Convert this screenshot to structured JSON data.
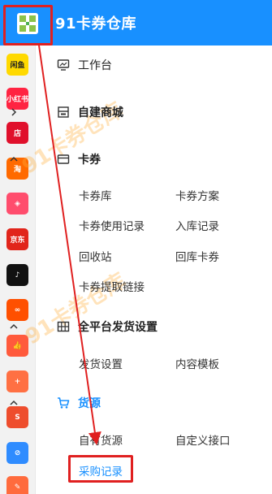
{
  "brand": {
    "title": "91卡券仓库"
  },
  "rail_icons": [
    {
      "name": "xianyu-app-icon",
      "label": "闲鱼",
      "bg": "#ffd900",
      "fg": "#222"
    },
    {
      "name": "xiaohongshu-app-icon",
      "label": "小红书",
      "bg": "#ff2442",
      "fg": "#fff"
    },
    {
      "name": "store-app-icon",
      "label": "店",
      "bg": "#e0102c",
      "fg": "#fff"
    },
    {
      "name": "taobao-app-icon",
      "label": "淘",
      "bg": "#ff6a00",
      "fg": "#fff"
    },
    {
      "name": "pattern-app-icon",
      "label": "◈",
      "bg": "#ff4d6d",
      "fg": "#fff"
    },
    {
      "name": "jd-app-icon",
      "label": "京东",
      "bg": "#e1251b",
      "fg": "#fff"
    },
    {
      "name": "tiktok-app-icon",
      "label": "♪",
      "bg": "#111111",
      "fg": "#fff"
    },
    {
      "name": "kuaishou-app-icon",
      "label": "∞",
      "bg": "#ff5000",
      "fg": "#fff"
    },
    {
      "name": "thumbs-up-app-icon",
      "label": "👍",
      "bg": "#ff5a3c",
      "fg": "#fff"
    },
    {
      "name": "bag-plus-app-icon",
      "label": "+",
      "bg": "#ff7043",
      "fg": "#fff"
    },
    {
      "name": "shopee-app-icon",
      "label": "S",
      "bg": "#ee4d2d",
      "fg": "#fff"
    },
    {
      "name": "link-app-icon",
      "label": "⊘",
      "bg": "#2f8cff",
      "fg": "#fff"
    },
    {
      "name": "bag-edit-app-icon",
      "label": "✎",
      "bg": "#ff6b3d",
      "fg": "#fff"
    }
  ],
  "menu": {
    "workbench": "工作台",
    "mall": "自建商城",
    "cards": {
      "title": "卡券",
      "items": [
        "卡券库",
        "卡券方案",
        "卡券使用记录",
        "入库记录",
        "回收站",
        "回库卡券",
        "卡券提取链接"
      ]
    },
    "shipping": {
      "title": "全平台发货设置",
      "items": [
        "发货设置",
        "内容模板"
      ]
    },
    "source": {
      "title": "货源",
      "items": [
        "自有货源",
        "自定义接口",
        "采购记录"
      ]
    }
  },
  "colors": {
    "accent": "#1890ff",
    "highlight": "#e02020"
  }
}
